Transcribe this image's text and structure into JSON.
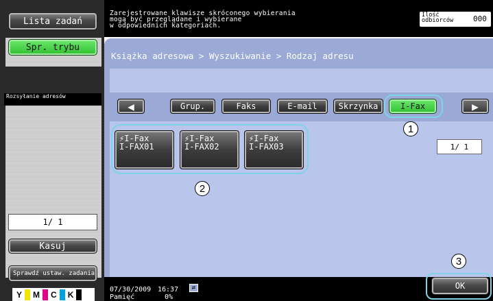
{
  "left": {
    "job_list_label": "Lista zadań",
    "mode_check_label": "Spr. trybu",
    "section_label": "Rozsyłanie adresów",
    "page_counter": "1/ 1",
    "delete_label": "Kasuj",
    "check_settings_label": "Sprawdź ustaw. zadania",
    "toner": [
      {
        "letter": "Y",
        "color": "#f2e600"
      },
      {
        "letter": "M",
        "color": "#e0008a"
      },
      {
        "letter": "C",
        "color": "#00a3e0"
      },
      {
        "letter": "K",
        "color": "#000000"
      }
    ]
  },
  "top": {
    "message_line1": "Zarejestrowane klawisze skróconego wybierania",
    "message_line2": "mogą być przeglądane i wybierane",
    "message_line3": "w odpowiednich kategoriach.",
    "recipients_label_line1": "Ilość",
    "recipients_label_line2": "odbiorców",
    "recipients_count": "000"
  },
  "main": {
    "breadcrumb": "Książka adresowa > Wyszukiwanie > Rodzaj adresu",
    "tabs": [
      "Grup.",
      "Faks",
      "E-mail",
      "Skrzynka",
      "I-Fax"
    ],
    "selected_tab": "I-Fax",
    "entries": [
      {
        "type": "I-Fax",
        "name": "I-FAX01"
      },
      {
        "type": "I-Fax",
        "name": "I-FAX02"
      },
      {
        "type": "I-Fax",
        "name": "I-FAX03"
      }
    ],
    "page_counter": "1/ 1",
    "callouts": [
      "1",
      "2",
      "3"
    ],
    "ok_label": "OK"
  },
  "status": {
    "date": "07/30/2009",
    "time": "16:37",
    "memory_label": "Pamięć",
    "memory_value": "0%"
  }
}
